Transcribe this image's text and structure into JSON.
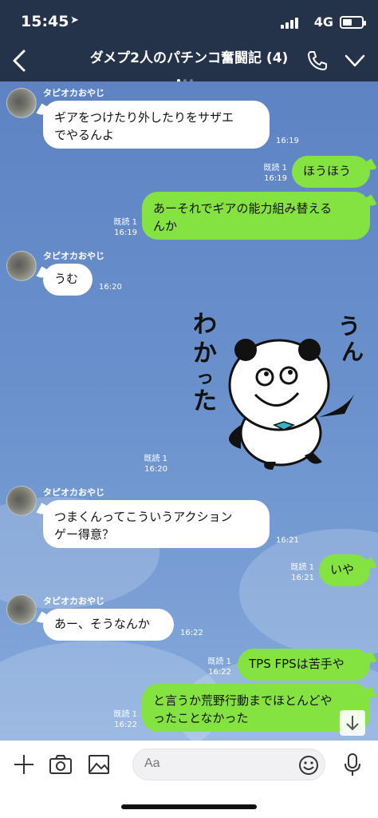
{
  "status": {
    "time": "15:45",
    "location_icon": "location-arrow-icon",
    "network": "4G",
    "battery_level": 0.5
  },
  "header": {
    "title": "ダメプ2人のパチンコ奮闘記 (4)",
    "page_dots": 3,
    "active_dot": 0
  },
  "messages": [
    {
      "id": "m1",
      "sender": "タピオカおやじ",
      "lines": [
        "ギアをつけたり外したりをサザエ",
        "でやるんよ"
      ],
      "time": "16:19"
    },
    {
      "id": "m2",
      "read": "既読 1",
      "time": "16:19",
      "lines": [
        "ほうほう"
      ]
    },
    {
      "id": "m3",
      "read": "既読 1",
      "time": "16:19",
      "lines": [
        "あーそれでギアの能力組み替える",
        "んか"
      ]
    },
    {
      "id": "m4",
      "sender": "タピオカおやじ",
      "lines": [
        "うむ"
      ],
      "time": "16:20"
    },
    {
      "id": "m5",
      "read": "既読 1",
      "time": "16:20",
      "sticker_text_1": "わかった",
      "sticker_text_2": "うん"
    },
    {
      "id": "m6",
      "sender": "タピオカおやじ",
      "lines": [
        "つまくんってこういうアクション",
        "ゲー得意？"
      ],
      "time": "16:21"
    },
    {
      "id": "m7",
      "read": "既読 1",
      "time": "16:21",
      "lines": [
        "いや"
      ]
    },
    {
      "id": "m8",
      "sender": "タピオカおやじ",
      "lines": [
        "あー、そうなんか"
      ],
      "time": "16:22"
    },
    {
      "id": "m9",
      "read": "既読 1",
      "time": "16:22",
      "lines": [
        "TPS FPSは苦手や"
      ]
    },
    {
      "id": "m10",
      "read": "既読 1",
      "time": "16:22",
      "lines": [
        "と言うか荒野行動までほとんどや",
        "ったことなかった"
      ]
    }
  ],
  "input": {
    "placeholder": "Aa"
  },
  "colors": {
    "header_bg": "#24324a",
    "outgoing_bubble": "#84e341",
    "incoming_bubble": "#ffffff",
    "chat_bg": "#6a90cc"
  }
}
